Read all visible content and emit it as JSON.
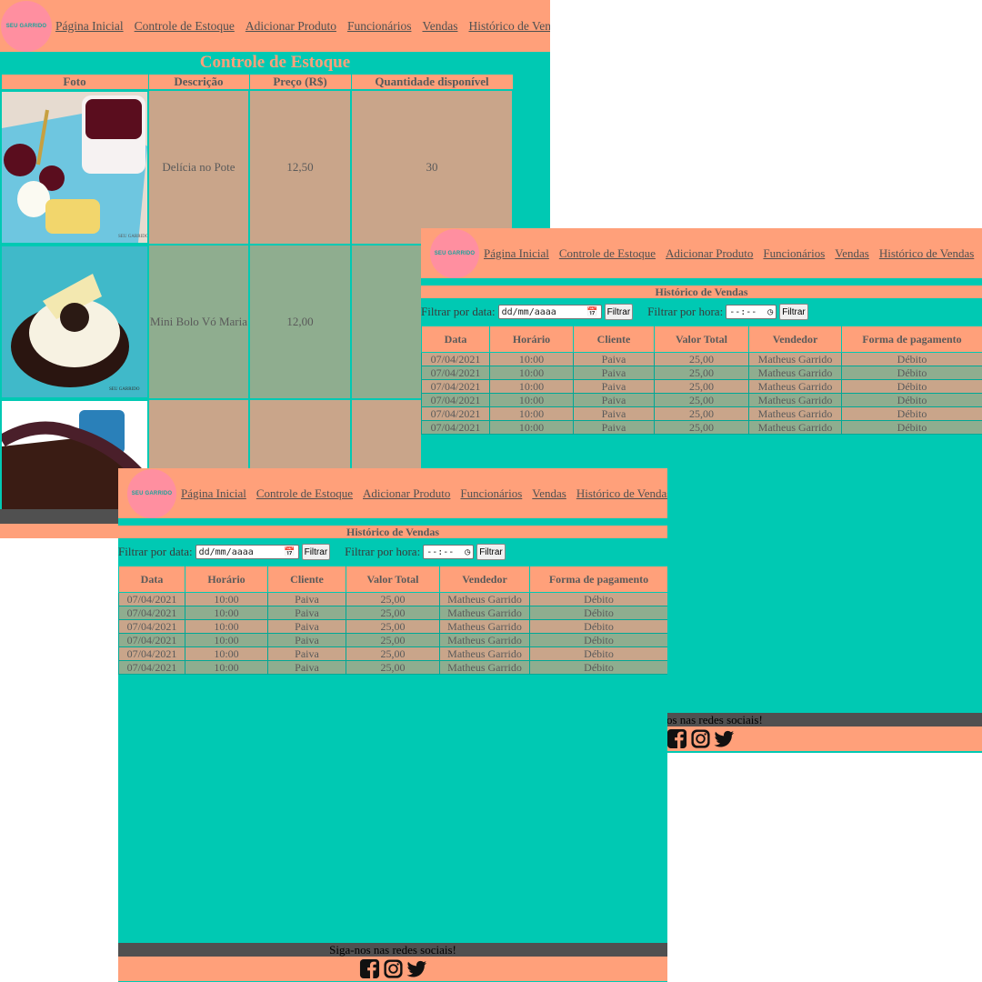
{
  "nav": {
    "items": [
      "Página Inicial",
      "Controle de Estoque",
      "Adicionar Produto",
      "Funcionários",
      "Vendas",
      "Histórico de Vendas"
    ]
  },
  "estoque": {
    "title": "Controle de Estoque",
    "headers": [
      "Foto",
      "Descrição",
      "Preço (R$)",
      "Quantidade disponível"
    ],
    "rows": [
      {
        "descricao": "Delícia no Pote",
        "preco": "12,50",
        "quantidade": "30"
      },
      {
        "descricao": "Mini Bolo Vó Maria",
        "preco": "12,00",
        "quantidade": ""
      },
      {
        "descricao": "",
        "preco": "",
        "quantidade": ""
      }
    ]
  },
  "historico": {
    "title": "Histórico de Vendas",
    "filter_date_label": "Filtrar por data:",
    "date_placeholder": "dd/mm/aaaa",
    "filter_time_label": "Filtrar por hora:",
    "time_placeholder": "--:--",
    "filter_button": "Filtrar",
    "headers": [
      "Data",
      "Horário",
      "Cliente",
      "Valor Total",
      "Vendedor",
      "Forma de pagamento"
    ],
    "rows": [
      [
        "07/04/2021",
        "10:00",
        "Paiva",
        "25,00",
        "Matheus Garrido",
        "Débito"
      ],
      [
        "07/04/2021",
        "10:00",
        "Paiva",
        "25,00",
        "Matheus Garrido",
        "Débito"
      ],
      [
        "07/04/2021",
        "10:00",
        "Paiva",
        "25,00",
        "Matheus Garrido",
        "Débito"
      ],
      [
        "07/04/2021",
        "10:00",
        "Paiva",
        "25,00",
        "Matheus Garrido",
        "Débito"
      ],
      [
        "07/04/2021",
        "10:00",
        "Paiva",
        "25,00",
        "Matheus Garrido",
        "Débito"
      ],
      [
        "07/04/2021",
        "10:00",
        "Paiva",
        "25,00",
        "Matheus Garrido",
        "Débito"
      ]
    ]
  },
  "footer": {
    "follow_text": "Siga-nos nas redes sociais!",
    "follow_text_partial": "os nas redes sociais!",
    "icons": [
      "facebook-icon",
      "instagram-icon",
      "twitter-icon"
    ]
  },
  "logo_text": "SEU GARRIDO",
  "colors": {
    "accent": "#ffa07a",
    "background": "#00c9b3",
    "row_odd": "#c9a58a",
    "row_even": "#8fad8f",
    "footer_bar": "#505050"
  }
}
